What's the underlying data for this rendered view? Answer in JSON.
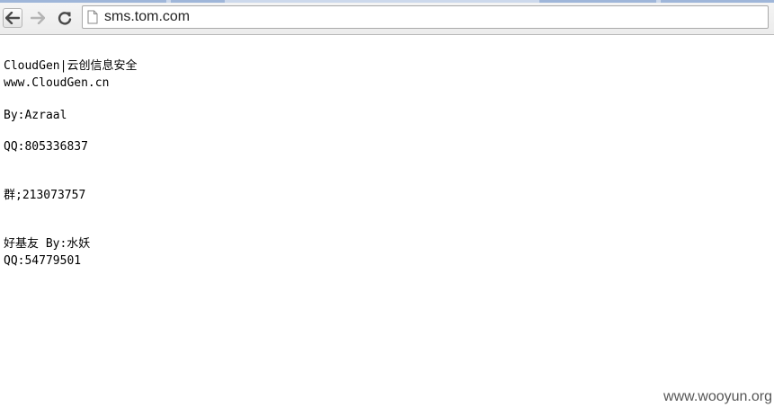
{
  "browser": {
    "url": "sms.tom.com",
    "icons": {
      "back": "back-arrow-icon",
      "forward": "forward-arrow-icon",
      "reload": "reload-icon",
      "page": "page-icon"
    }
  },
  "content": {
    "lines": [
      "CloudGen|云创信息安全",
      "www.CloudGen.cn",
      "By:Azraal",
      "QQ:805336837",
      "群;213073757",
      "好基友 By:水妖",
      "QQ:54779501"
    ]
  },
  "watermark": "www.wooyun.org"
}
